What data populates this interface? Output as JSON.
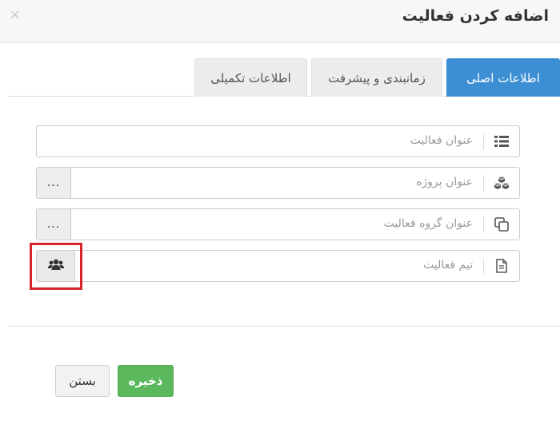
{
  "dialog": {
    "title": "اضافه کردن فعالیت",
    "close_symbol": "×"
  },
  "tabs": [
    {
      "label": "اطلاعات اصلی",
      "active": true
    },
    {
      "label": "زمانبندی و پیشرفت",
      "active": false
    },
    {
      "label": "اطلاعات تکمیلی",
      "active": false
    }
  ],
  "form": {
    "activity_title": {
      "placeholder": "عنوان فعالیت",
      "value": "",
      "icon": "list-icon"
    },
    "project_title": {
      "placeholder": "عنوان پروژه",
      "value": "",
      "icon": "cubes-icon",
      "button_label": "..."
    },
    "activity_group_title": {
      "placeholder": "عنوان گروه فعالیت",
      "value": "",
      "icon": "copy-icon",
      "button_label": "..."
    },
    "activity_team": {
      "placeholder": "تیم فعالیت",
      "value": "",
      "icon": "document-icon",
      "button_icon": "users-icon"
    }
  },
  "footer": {
    "save_label": "ذخیره",
    "close_label": "بستن"
  },
  "colors": {
    "active_tab": "#3d8fd3",
    "save_button": "#5cb85c",
    "highlight_border": "#d9232a"
  }
}
